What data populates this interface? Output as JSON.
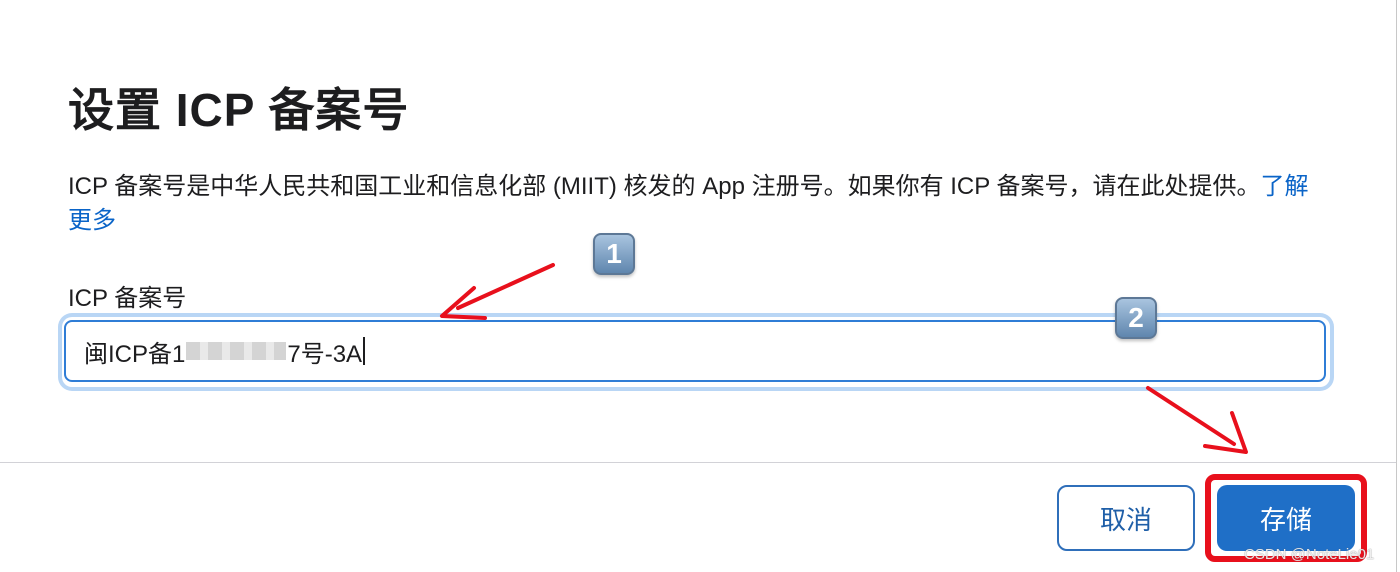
{
  "dialog": {
    "title": "设置 ICP 备案号",
    "description": "ICP 备案号是中华人民共和国工业和信息化部 (MIIT) 核发的 App 注册号。如果你有 ICP 备案号，请在此处提供。",
    "learn_more_link": "了解更多",
    "field_label": "ICP 备案号",
    "field_value_prefix": "闽ICP备1",
    "field_value_suffix": "7号-3A",
    "cancel_label": "取消",
    "save_label": "存储"
  },
  "annotations": {
    "badge_1": "1",
    "badge_2": "2",
    "arrow_color": "#e8101c",
    "highlight_color": "#e8101c"
  },
  "watermark": "CSDN @NoteLie01",
  "colors": {
    "link": "#0a64c8",
    "primary_button": "#1f6fc7",
    "input_focus_border": "#2f7dd6"
  }
}
